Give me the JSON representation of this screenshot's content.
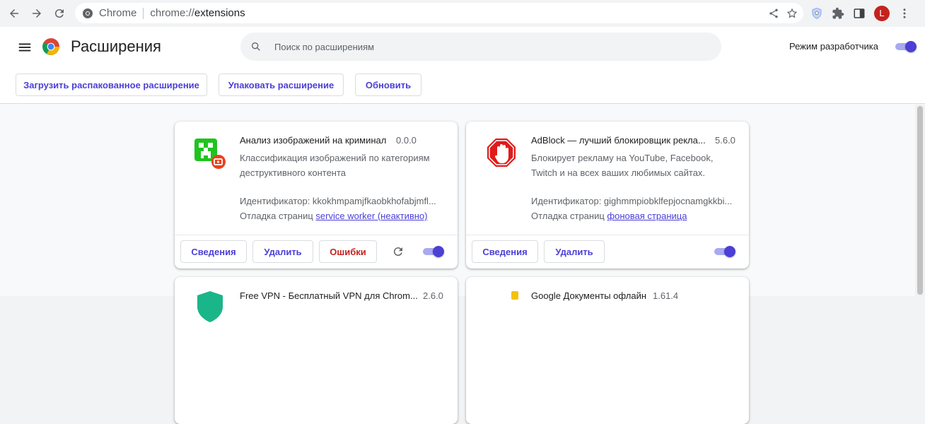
{
  "browser": {
    "chip_label": "Chrome",
    "url_scheme": "chrome://",
    "url_path": "extensions",
    "avatar_letter": "L"
  },
  "header": {
    "title": "Расширения",
    "search_placeholder": "Поиск по расширениям",
    "dev_mode_label": "Режим разработчика",
    "dev_mode_on": true,
    "buttons": {
      "load_unpacked": "Загрузить распакованное расширение",
      "pack": "Упаковать расширение",
      "update": "Обновить"
    }
  },
  "extensions": [
    {
      "name": "Анализ изображений на криминал",
      "version": "0.0.0",
      "description": "Классификация изображений по категориям деструктивного контента",
      "id_label": "Идентификатор: kkokhmpamjfkaobkhofabjmfl...",
      "inspect_label": "Отладка страниц",
      "inspect_link": "service worker (неактивно)",
      "details_label": "Сведения",
      "remove_label": "Удалить",
      "errors_label": "Ошибки",
      "enabled": true,
      "icon": "green-creeper-icon"
    },
    {
      "name": "AdBlock — лучший блокировщик рекла...",
      "version": "5.6.0",
      "description": "Блокирует рекламу на YouTube, Facebook, Twitch и на всех ваших любимых сайтах.",
      "id_label": "Идентификатор: gighmmpiobklfepjocnamgkkbi...",
      "inspect_label": "Отладка страниц",
      "inspect_link": "фоновая страница",
      "details_label": "Сведения",
      "remove_label": "Удалить",
      "enabled": true,
      "icon": "adblock-hand-icon"
    },
    {
      "name": "Free VPN - Бесплатный VPN для Chrom...",
      "version": "2.6.0",
      "icon": "vpn-shield-icon"
    },
    {
      "name": "Google Документы офлайн",
      "version": "1.61.4",
      "icon": "google-docs-icon"
    }
  ],
  "colors": {
    "accent": "#4b3fd6",
    "error": "#c5221f"
  }
}
